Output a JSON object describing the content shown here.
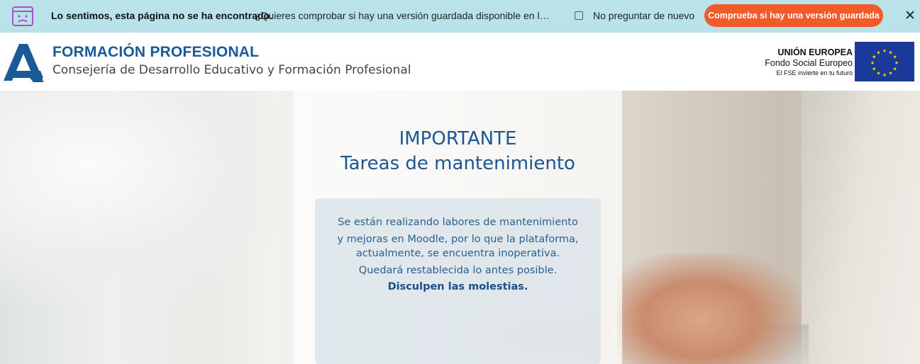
{
  "wayback_bar": {
    "title": "Lo sentimos, esta página no se ha encontrado.",
    "question": "¿Quieres comprobar si hay una versión guardada disponible en la Wayback Machine?",
    "checkbox_label": "No preguntar de nuevo",
    "check_button_label": "Comprueba si hay una versión guardada",
    "close_glyph": "✕",
    "background_color": "#b9e3e8",
    "button_color": "#f25a2a"
  },
  "header": {
    "title": "FORMACIÓN PROFESIONAL",
    "subtitle": "Consejería de Desarrollo Educativo y Formación Profesional",
    "eu": {
      "title": "UNIÓN EUROPEA",
      "fund": "Fondo Social Europeo",
      "tagline": "El FSE invierte en tu futuro"
    },
    "brand_color": "#1a5a99"
  },
  "hero": {
    "title": "IMPORTANTE",
    "subtitle": "Tareas de mantenimiento",
    "message_lines": [
      "Se están realizando labores de mantenimiento",
      "y mejoras en Moodle, por lo que la plataforma,",
      "actualmente, se encuentra inoperativa.",
      "Quedará restablecida lo antes posible."
    ],
    "closing": "Disculpen las molestias.",
    "text_color": "#1b5592"
  }
}
